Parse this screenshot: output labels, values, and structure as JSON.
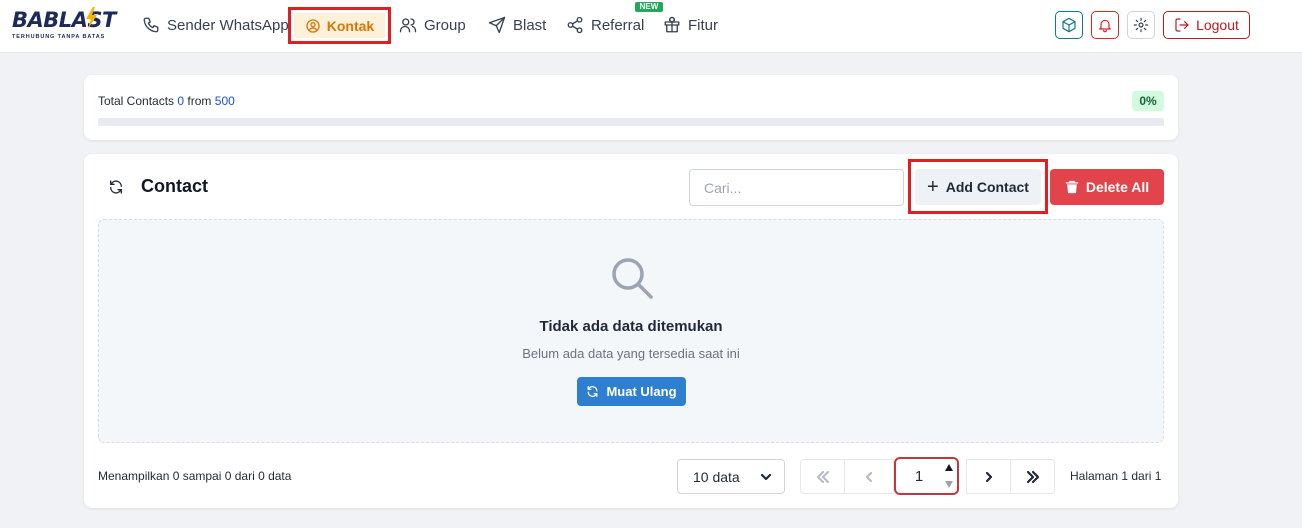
{
  "app": {
    "logo_text": "BABLAST",
    "logo_tagline": "TERHUBUNG TANPA BATAS"
  },
  "nav": {
    "items": [
      {
        "label": "Sender WhatsApp",
        "icon": "phone-icon"
      },
      {
        "label": "Kontak",
        "icon": "user-circle-icon",
        "active": true
      },
      {
        "label": "Group",
        "icon": "users-icon"
      },
      {
        "label": "Blast",
        "icon": "send-icon"
      },
      {
        "label": "Referral",
        "icon": "share-icon",
        "badge": "NEW"
      },
      {
        "label": "Fitur",
        "icon": "gift-icon"
      }
    ],
    "logout_label": "Logout"
  },
  "summary": {
    "prefix": "Total Contacts",
    "current": "0",
    "from_label": "from",
    "limit": "500",
    "percent_label": "0%",
    "progress": 0
  },
  "contact": {
    "title": "Contact",
    "search_placeholder": "Cari...",
    "add_label": "Add Contact",
    "delete_all_label": "Delete All",
    "empty_title": "Tidak ada data ditemukan",
    "empty_subtitle": "Belum ada data yang tersedia saat ini",
    "reload_label": "Muat Ulang",
    "showing_text": "Menampilkan 0 sampai 0 dari 0 data",
    "page_size": "10 data",
    "current_page": "1",
    "page_info": "Halaman 1 dari 1"
  },
  "colors": {
    "accent_orange": "#d97706",
    "highlight_red": "#e21e25",
    "danger": "#e2444b",
    "primary_blue": "#2f7fd1",
    "success_green": "#22a75b"
  }
}
